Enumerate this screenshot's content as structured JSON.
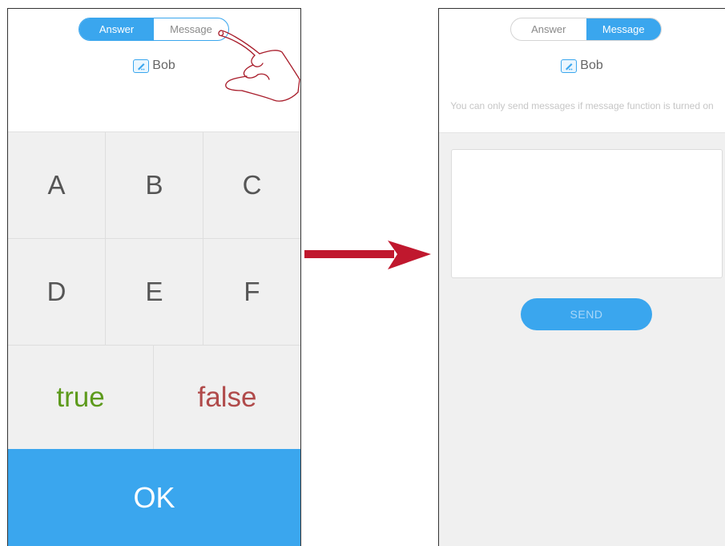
{
  "left_screen": {
    "tabs": [
      {
        "label": "Answer",
        "active": true
      },
      {
        "label": "Message",
        "active": false
      }
    ],
    "user_name": "Bob",
    "options_row1": [
      "A",
      "B",
      "C"
    ],
    "options_row2": [
      "D",
      "E",
      "F"
    ],
    "true_label": "true",
    "false_label": "false",
    "ok_label": "OK"
  },
  "right_screen": {
    "tabs": [
      {
        "label": "Answer",
        "active": false
      },
      {
        "label": "Message",
        "active": true
      }
    ],
    "user_name": "Bob",
    "notice": "You can only send messages if message function is turned on",
    "message_value": "",
    "send_label": "SEND"
  },
  "colors": {
    "accent": "#3aa6ee",
    "true_color": "#5d9a1c",
    "false_color": "#b04a4a",
    "arrow": "#c0182e",
    "hand_outline": "#a81c2a"
  },
  "icons": [
    "edit-icon",
    "pointing-hand-icon",
    "arrow-right-icon"
  ]
}
